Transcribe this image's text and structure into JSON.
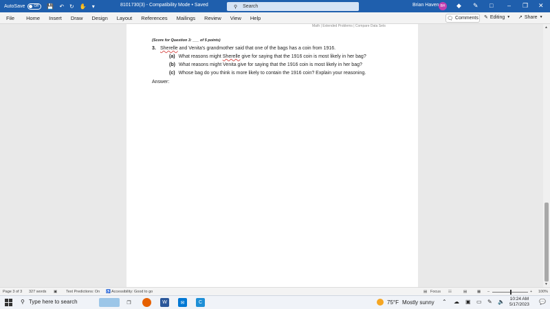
{
  "titlebar": {
    "autosave_label": "AutoSave",
    "autosave_state": "Off",
    "document_title": "8101730(3)  -  Compatibility Mode • Saved",
    "search_placeholder": "Search",
    "user_name": "Brian Haven",
    "user_initials": "BH"
  },
  "menu": {
    "items": [
      "File",
      "Home",
      "Insert",
      "Draw",
      "Design",
      "Layout",
      "References",
      "Mailings",
      "Review",
      "View",
      "Help"
    ],
    "comments_label": "Comments",
    "editing_label": "Editing",
    "share_label": "Share"
  },
  "document": {
    "header_fragment": "Math | Extended Problems | Compare Data Sets",
    "score_line": "(Score for Question 3: ___ of 5 points)",
    "question_number": "3.",
    "question_name": "Sherelle",
    "question_rest": " and Venita's grandmother said that one of the bags has a coin from 1916.",
    "parts": [
      {
        "label": "(a)",
        "pre": "What reasons might ",
        "name": "Sherelle",
        "post": " give for saying that the 1916 coin is most likely in her bag?"
      },
      {
        "label": "(b)",
        "pre": "What reasons might Venita give for saying that the 1916 coin is most likely in her bag?",
        "name": "",
        "post": ""
      },
      {
        "label": "(c)",
        "pre": "Whose bag do you think is more likely to contain the 1916 coin? Explain your reasoning.",
        "name": "",
        "post": ""
      }
    ],
    "answer_label": "Answer:"
  },
  "statusbar": {
    "page": "Page 3 of 3",
    "words": "327 words",
    "text_predictions": "Text Predictions: On",
    "accessibility": "Accessibility: Good to go",
    "focus": "Focus",
    "zoom": "100%"
  },
  "taskbar": {
    "search_placeholder": "Type here to search",
    "temperature": "75°F",
    "weather": "Mostly sunny",
    "time": "10:24 AM",
    "date": "5/17/2023"
  }
}
